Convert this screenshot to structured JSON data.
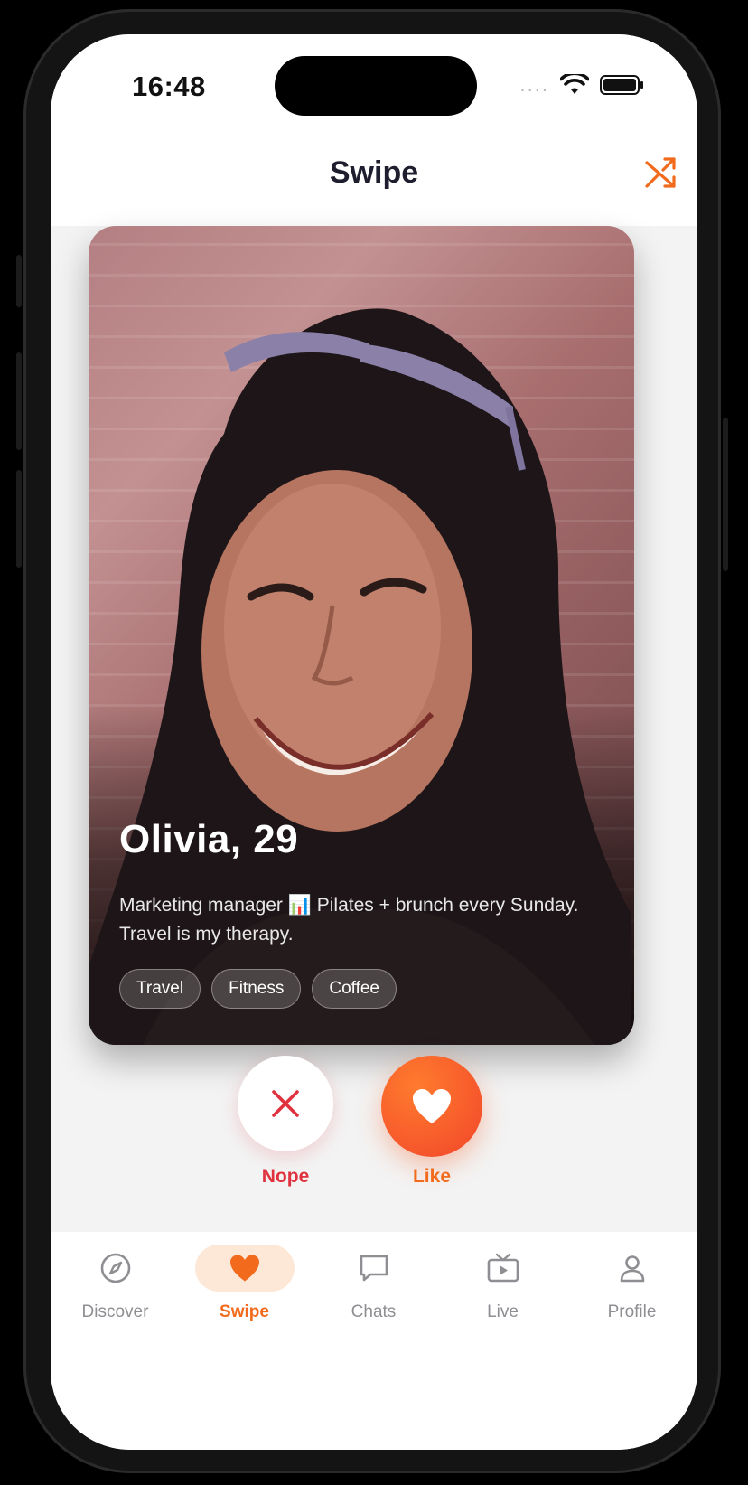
{
  "status_bar": {
    "time": "16:48",
    "signal_dots": "....",
    "wifi_icon": "wifi-icon",
    "battery_icon": "battery-icon"
  },
  "header": {
    "title": "Swipe",
    "shuffle_icon": "shuffle-icon"
  },
  "card": {
    "name_age": "Olivia, 29",
    "bio": "Marketing manager 📊 Pilates + brunch every Sunday. Travel is my therapy.",
    "tags": [
      "Travel",
      "Fitness",
      "Coffee"
    ]
  },
  "actions": {
    "nope_label": "Nope",
    "like_label": "Like"
  },
  "tabs": [
    {
      "label": "Discover",
      "icon": "compass-icon"
    },
    {
      "label": "Swipe",
      "icon": "heart-icon",
      "active": true
    },
    {
      "label": "Chats",
      "icon": "chat-bubble-icon"
    },
    {
      "label": "Live",
      "icon": "tv-play-icon"
    },
    {
      "label": "Profile",
      "icon": "user-icon"
    }
  ],
  "colors": {
    "accent": "#f26b1d",
    "nope": "#e0323e",
    "title": "#1e1e2e"
  }
}
